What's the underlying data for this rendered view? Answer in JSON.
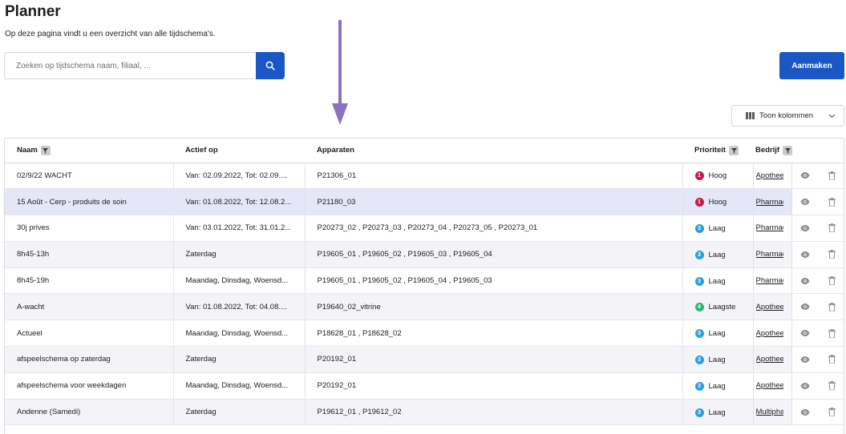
{
  "page": {
    "title": "Planner",
    "subtitle": "Op deze pagina vindt u een overzicht van alle tijdschema's."
  },
  "search": {
    "placeholder": "Zoeken op tijdschema naam, filiaal, ...",
    "value": ""
  },
  "actions": {
    "create_label": "Aanmaken",
    "columns_label": "Toon kolommen"
  },
  "table": {
    "headers": {
      "name": "Naam",
      "active": "Actief op",
      "devices": "Apparaten",
      "priority": "Prioriteit",
      "company": "Bedrijf"
    },
    "rows": [
      {
        "name": "02/9/22 WACHT",
        "active": "Van: 02.09.2022, Tot: 02.09....",
        "devices": "P21306_01",
        "priority": "Hoog",
        "priority_num": "1",
        "priority_color": "#c8184a",
        "company": "Apotheek"
      },
      {
        "name": "15 Août - Cerp - produits de soin",
        "active": "Van: 01.08.2022, Tot: 12.08.2...",
        "devices": "P21180_03",
        "priority": "Hoog",
        "priority_num": "1",
        "priority_color": "#c8184a",
        "company": "Pharmacie"
      },
      {
        "name": "30j prives",
        "active": "Van: 03.01.2022, Tot: 31.01.2...",
        "devices": "P20273_02 , P20273_03 , P20273_04 , P20273_05 , P20273_01",
        "priority": "Laag",
        "priority_num": "3",
        "priority_color": "#2f9fd8",
        "company": "Pharmacie"
      },
      {
        "name": "8h45-13h",
        "active": "Zaterdag",
        "devices": "P19605_01 , P19605_02 , P19605_03 , P19605_04",
        "priority": "Laag",
        "priority_num": "3",
        "priority_color": "#2f9fd8",
        "company": "Pharmacie"
      },
      {
        "name": "8h45-19h",
        "active": "Maandag, Dinsdag, Woensd...",
        "devices": "P19605_01 , P19605_02 , P19605_04 , P19605_03",
        "priority": "Laag",
        "priority_num": "3",
        "priority_color": "#2f9fd8",
        "company": "Pharmacie"
      },
      {
        "name": "A-wacht",
        "active": "Van: 01.08.2022, Tot: 04.08....",
        "devices": "P19640_02_vitrine",
        "priority": "Laagste",
        "priority_num": "4",
        "priority_color": "#2bb673",
        "company": "Apotheek"
      },
      {
        "name": "Actueel",
        "active": "Maandag, Dinsdag, Woensd...",
        "devices": "P18628_01 , P18628_02",
        "priority": "Laag",
        "priority_num": "3",
        "priority_color": "#2f9fd8",
        "company": "Apotheek"
      },
      {
        "name": "afspeelschema op zaterdag",
        "active": "Zaterdag",
        "devices": "P20192_01",
        "priority": "Laag",
        "priority_num": "3",
        "priority_color": "#2f9fd8",
        "company": "Apotheek"
      },
      {
        "name": "afspeelschema voor weekdagen",
        "active": "Maandag, Dinsdag, Woensd...",
        "devices": "P20192_01",
        "priority": "Laag",
        "priority_num": "3",
        "priority_color": "#2f9fd8",
        "company": "Apotheek"
      },
      {
        "name": "Andenne (Samedi)",
        "active": "Zaterdag",
        "devices": "P19612_01 , P19612_02",
        "priority": "Laag",
        "priority_num": "3",
        "priority_color": "#2f9fd8",
        "company": "Multipharma"
      }
    ]
  },
  "icons": {
    "search": "search-icon",
    "columns": "columns-icon",
    "chevron": "chevron-down-icon",
    "filter": "filter-icon",
    "view": "eye-icon",
    "delete": "trash-icon"
  },
  "colors": {
    "primary": "#1a56c4",
    "arrow": "#8a72c0",
    "selected_row": "#e5e6f8"
  }
}
